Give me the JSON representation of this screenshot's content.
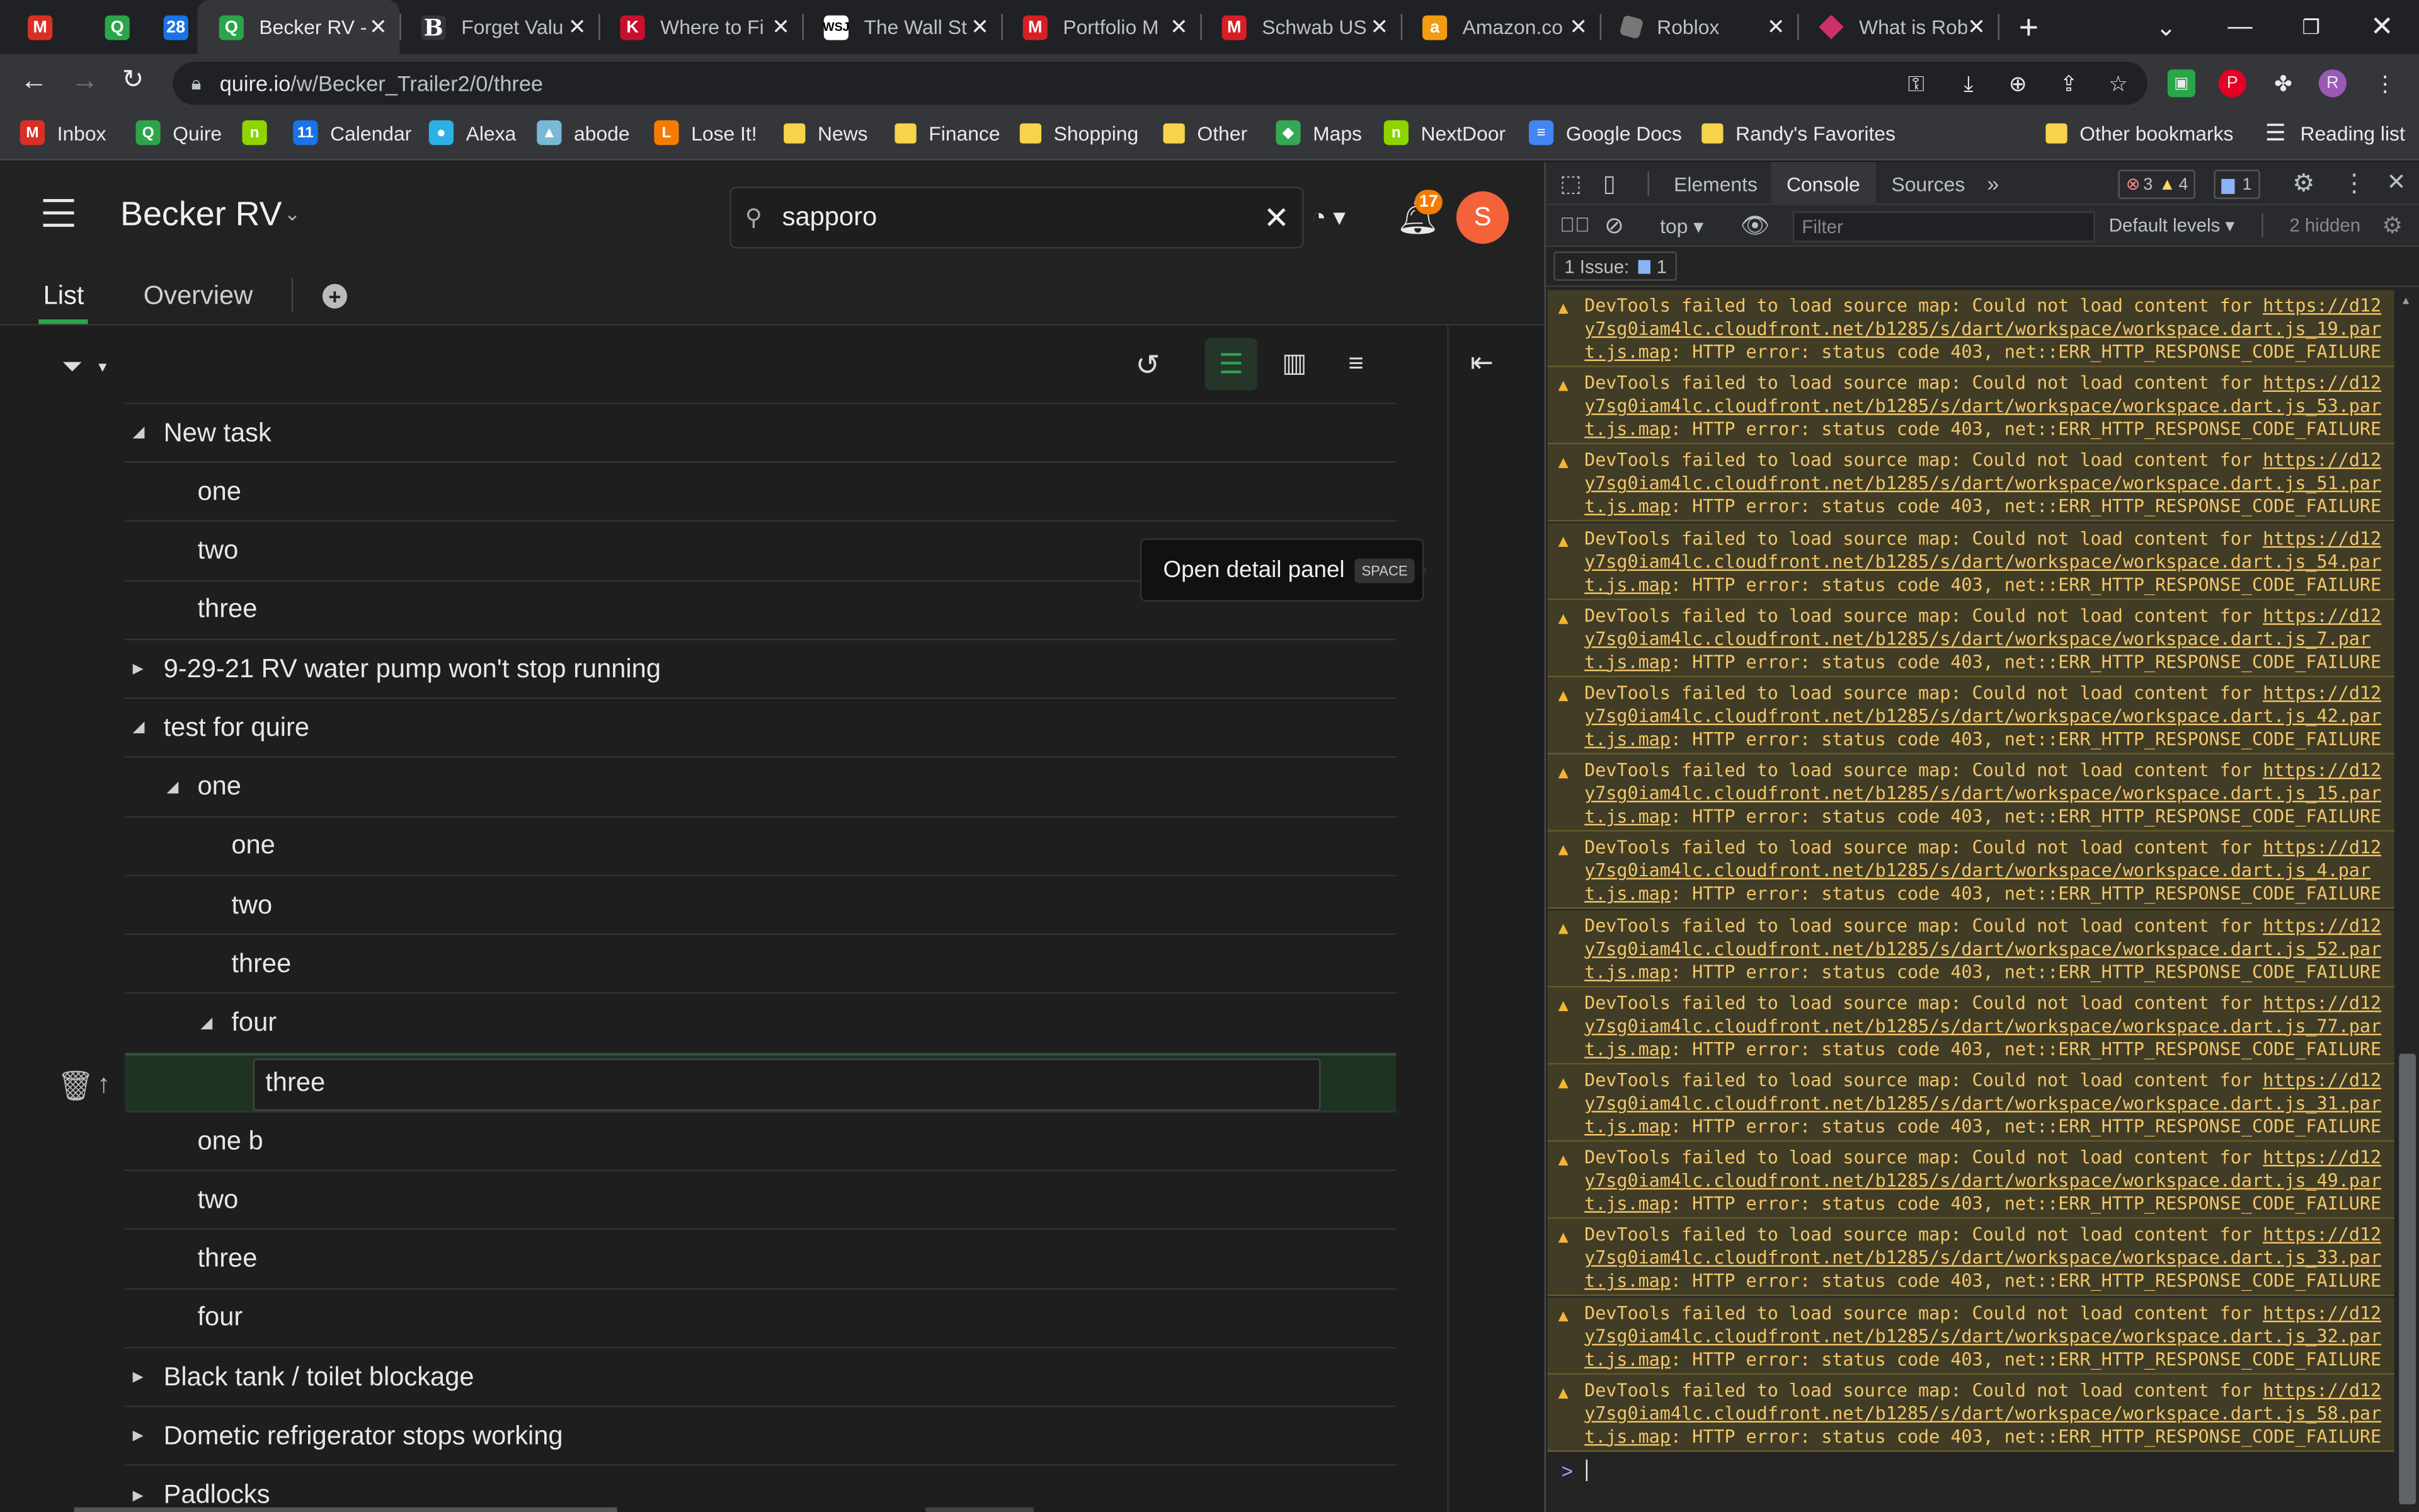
{
  "browser": {
    "tabs": [
      {
        "title": "",
        "icon": "gmail-icon",
        "fav": "M",
        "color": "#d93025"
      },
      {
        "title": "",
        "icon": "quire-icon",
        "fav": "Q",
        "color": "#2aa54a"
      },
      {
        "title": "",
        "icon": "calendar-icon",
        "fav": "28",
        "color": "#1a73e8"
      },
      {
        "title": "Becker RV -",
        "icon": "quire-icon",
        "fav": "Q",
        "color": "#2aa54a"
      },
      {
        "title": "Forget Valu",
        "icon": "barrons-icon",
        "fav": "B",
        "color": "#35363a"
      },
      {
        "title": "Where to Fi",
        "icon": "kiplinger-icon",
        "fav": "K",
        "color": "#c8102e"
      },
      {
        "title": "The Wall St",
        "icon": "wsj-icon",
        "fav": "WSJ",
        "color": "#ffffff"
      },
      {
        "title": "Portfolio M",
        "icon": "morningstar-icon",
        "fav": "M",
        "color": "#d71f26"
      },
      {
        "title": "Schwab US",
        "icon": "morningstar-icon",
        "fav": "M",
        "color": "#d71f26"
      },
      {
        "title": "Amazon.co",
        "icon": "amazon-icon",
        "fav": "a",
        "color": "#f39c12"
      },
      {
        "title": "Roblox",
        "icon": "roblox-icon",
        "fav": "",
        "color": "#777777"
      },
      {
        "title": "What is Rob",
        "icon": "robinhood-icon",
        "fav": "",
        "color": "#d0306a"
      }
    ],
    "new_tab": "+",
    "address": {
      "host": "quire.io",
      "path": "/w/Becker_Trailer2/0/three"
    },
    "bookmarks": [
      {
        "label": "Inbox",
        "icon": "gmail-icon",
        "color": "#d93025",
        "glyph": "M"
      },
      {
        "label": "Quire",
        "icon": "quire-icon",
        "color": "#2aa54a",
        "glyph": "Q"
      },
      {
        "label": "",
        "icon": "nextdoor-icon",
        "color": "#8ed500",
        "glyph": "n"
      },
      {
        "label": "Calendar",
        "icon": "calendar-icon",
        "color": "#1a73e8",
        "glyph": "11"
      },
      {
        "label": "Alexa",
        "icon": "alexa-icon",
        "color": "#2db0e6",
        "glyph": "●"
      },
      {
        "label": "abode",
        "icon": "abode-icon",
        "color": "#7ab8d8",
        "glyph": "▲"
      },
      {
        "label": "Lose It!",
        "icon": "loseit-icon",
        "color": "#f57c00",
        "glyph": "L"
      },
      {
        "label": "News",
        "icon": "folder-icon",
        "color": "",
        "glyph": ""
      },
      {
        "label": "Finance",
        "icon": "folder-icon",
        "color": "",
        "glyph": ""
      },
      {
        "label": "Shopping",
        "icon": "folder-icon",
        "color": "",
        "glyph": ""
      },
      {
        "label": "Other",
        "icon": "folder-icon",
        "color": "",
        "glyph": ""
      },
      {
        "label": "Maps",
        "icon": "maps-icon",
        "color": "#34a853",
        "glyph": "◆"
      },
      {
        "label": "NextDoor",
        "icon": "nextdoor-icon",
        "color": "#8ed500",
        "glyph": "n"
      },
      {
        "label": "Google Docs",
        "icon": "docs-icon",
        "color": "#4285f4",
        "glyph": "≡"
      },
      {
        "label": "Randy's Favorites",
        "icon": "folder-icon",
        "color": "",
        "glyph": ""
      },
      {
        "label": "Other bookmarks",
        "icon": "folder-icon",
        "color": "",
        "glyph": ""
      },
      {
        "label": "Reading list",
        "icon": "reading-list-icon",
        "color": "",
        "glyph": "☰"
      }
    ],
    "profile_initial": "R"
  },
  "app": {
    "project_title": "Becker RV",
    "search_value": "sapporo",
    "notification_count": "17",
    "avatar_initial": "S",
    "view_tabs": [
      "List",
      "Overview"
    ],
    "tooltip": {
      "text": "Open detail panel",
      "key": "SPACE"
    },
    "editing_value": "three",
    "tasks": [
      {
        "label": "New task",
        "level": 0,
        "toggle": "expanded"
      },
      {
        "label": "one",
        "level": 1,
        "toggle": "none"
      },
      {
        "label": "two",
        "level": 1,
        "toggle": "none"
      },
      {
        "label": "three",
        "level": 1,
        "toggle": "none"
      },
      {
        "label": "9-29-21 RV water pump won't stop running",
        "level": 0,
        "toggle": "collapsed"
      },
      {
        "label": "test for quire",
        "level": 0,
        "toggle": "expanded"
      },
      {
        "label": "one",
        "level": 1,
        "toggle": "expanded"
      },
      {
        "label": "one",
        "level": 2,
        "toggle": "none"
      },
      {
        "label": "two",
        "level": 2,
        "toggle": "none"
      },
      {
        "label": "three",
        "level": 2,
        "toggle": "none"
      },
      {
        "label": "four",
        "level": 2,
        "toggle": "expanded"
      },
      {
        "label": "three",
        "level": 3,
        "toggle": "none",
        "editing": true
      },
      {
        "label": "one b",
        "level": 1,
        "toggle": "none"
      },
      {
        "label": "two",
        "level": 1,
        "toggle": "none"
      },
      {
        "label": "three",
        "level": 1,
        "toggle": "none"
      },
      {
        "label": "four",
        "level": 1,
        "toggle": "none"
      },
      {
        "label": "Black tank / toilet blockage",
        "level": 0,
        "toggle": "collapsed"
      },
      {
        "label": "Dometic refrigerator stops working",
        "level": 0,
        "toggle": "collapsed"
      },
      {
        "label": "Padlocks",
        "level": 0,
        "toggle": "collapsed"
      }
    ]
  },
  "devtools": {
    "tabs": [
      "Elements",
      "Console",
      "Sources"
    ],
    "active_tab": "Console",
    "errors": "3",
    "warnings": "4",
    "info": "1",
    "context": "top",
    "filter_placeholder": "Filter",
    "levels": "Default levels",
    "hidden": "2 hidden",
    "issues_label": "1 Issue:",
    "issues_count": "1",
    "messages": [
      {
        "prefix": "DevTools failed to load source map: Could not load content for ",
        "url1": "https://d12",
        "url2": "y7sg0iam4lc.cloudfront.net/b1285/s/dart/workspace/workspace.dart.js_19.par",
        "url3": "t.js.map",
        "suffix": ": HTTP error: status code 403, net::ERR_HTTP_RESPONSE_CODE_FAILURE"
      },
      {
        "prefix": "DevTools failed to load source map: Could not load content for ",
        "url1": "https://d12",
        "url2": "y7sg0iam4lc.cloudfront.net/b1285/s/dart/workspace/workspace.dart.js_53.par",
        "url3": "t.js.map",
        "suffix": ": HTTP error: status code 403, net::ERR_HTTP_RESPONSE_CODE_FAILURE"
      },
      {
        "prefix": "DevTools failed to load source map: Could not load content for ",
        "url1": "https://d12",
        "url2": "y7sg0iam4lc.cloudfront.net/b1285/s/dart/workspace/workspace.dart.js_51.par",
        "url3": "t.js.map",
        "suffix": ": HTTP error: status code 403, net::ERR_HTTP_RESPONSE_CODE_FAILURE"
      },
      {
        "prefix": "DevTools failed to load source map: Could not load content for ",
        "url1": "https://d12",
        "url2": "y7sg0iam4lc.cloudfront.net/b1285/s/dart/workspace/workspace.dart.js_54.par",
        "url3": "t.js.map",
        "suffix": ": HTTP error: status code 403, net::ERR_HTTP_RESPONSE_CODE_FAILURE"
      },
      {
        "prefix": "DevTools failed to load source map: Could not load content for ",
        "url1": "https://d12",
        "url2": "y7sg0iam4lc.cloudfront.net/b1285/s/dart/workspace/workspace.dart.js_7.par",
        "url3": "t.js.map",
        "suffix": ": HTTP error: status code 403, net::ERR_HTTP_RESPONSE_CODE_FAILURE"
      },
      {
        "prefix": "DevTools failed to load source map: Could not load content for ",
        "url1": "https://d12",
        "url2": "y7sg0iam4lc.cloudfront.net/b1285/s/dart/workspace/workspace.dart.js_42.par",
        "url3": "t.js.map",
        "suffix": ": HTTP error: status code 403, net::ERR_HTTP_RESPONSE_CODE_FAILURE"
      },
      {
        "prefix": "DevTools failed to load source map: Could not load content for ",
        "url1": "https://d12",
        "url2": "y7sg0iam4lc.cloudfront.net/b1285/s/dart/workspace/workspace.dart.js_15.par",
        "url3": "t.js.map",
        "suffix": ": HTTP error: status code 403, net::ERR_HTTP_RESPONSE_CODE_FAILURE"
      },
      {
        "prefix": "DevTools failed to load source map: Could not load content for ",
        "url1": "https://d12",
        "url2": "y7sg0iam4lc.cloudfront.net/b1285/s/dart/workspace/workspace.dart.js_4.par",
        "url3": "t.js.map",
        "suffix": ": HTTP error: status code 403, net::ERR_HTTP_RESPONSE_CODE_FAILURE"
      },
      {
        "prefix": "DevTools failed to load source map: Could not load content for ",
        "url1": "https://d12",
        "url2": "y7sg0iam4lc.cloudfront.net/b1285/s/dart/workspace/workspace.dart.js_52.par",
        "url3": "t.js.map",
        "suffix": ": HTTP error: status code 403, net::ERR_HTTP_RESPONSE_CODE_FAILURE"
      },
      {
        "prefix": "DevTools failed to load source map: Could not load content for ",
        "url1": "https://d12",
        "url2": "y7sg0iam4lc.cloudfront.net/b1285/s/dart/workspace/workspace.dart.js_77.par",
        "url3": "t.js.map",
        "suffix": ": HTTP error: status code 403, net::ERR_HTTP_RESPONSE_CODE_FAILURE"
      },
      {
        "prefix": "DevTools failed to load source map: Could not load content for ",
        "url1": "https://d12",
        "url2": "y7sg0iam4lc.cloudfront.net/b1285/s/dart/workspace/workspace.dart.js_31.par",
        "url3": "t.js.map",
        "suffix": ": HTTP error: status code 403, net::ERR_HTTP_RESPONSE_CODE_FAILURE"
      },
      {
        "prefix": "DevTools failed to load source map: Could not load content for ",
        "url1": "https://d12",
        "url2": "y7sg0iam4lc.cloudfront.net/b1285/s/dart/workspace/workspace.dart.js_49.par",
        "url3": "t.js.map",
        "suffix": ": HTTP error: status code 403, net::ERR_HTTP_RESPONSE_CODE_FAILURE"
      },
      {
        "prefix": "DevTools failed to load source map: Could not load content for ",
        "url1": "https://d12",
        "url2": "y7sg0iam4lc.cloudfront.net/b1285/s/dart/workspace/workspace.dart.js_33.par",
        "url3": "t.js.map",
        "suffix": ": HTTP error: status code 403, net::ERR_HTTP_RESPONSE_CODE_FAILURE"
      },
      {
        "prefix": "DevTools failed to load source map: Could not load content for ",
        "url1": "https://d12",
        "url2": "y7sg0iam4lc.cloudfront.net/b1285/s/dart/workspace/workspace.dart.js_32.par",
        "url3": "t.js.map",
        "suffix": ": HTTP error: status code 403, net::ERR_HTTP_RESPONSE_CODE_FAILURE"
      },
      {
        "prefix": "DevTools failed to load source map: Could not load content for ",
        "url1": "https://d12",
        "url2": "y7sg0iam4lc.cloudfront.net/b1285/s/dart/workspace/workspace.dart.js_58.par",
        "url3": "t.js.map",
        "suffix": ": HTTP error: status code 403, net::ERR_HTTP_RESPONSE_CODE_FAILURE"
      }
    ],
    "prompt": ">"
  },
  "colors": {
    "accent": "#2aa54a",
    "notification": "#f57c00",
    "avatar": "#f4623a",
    "warning_bg": "#413c25",
    "warning_text": "#f2c66b"
  }
}
